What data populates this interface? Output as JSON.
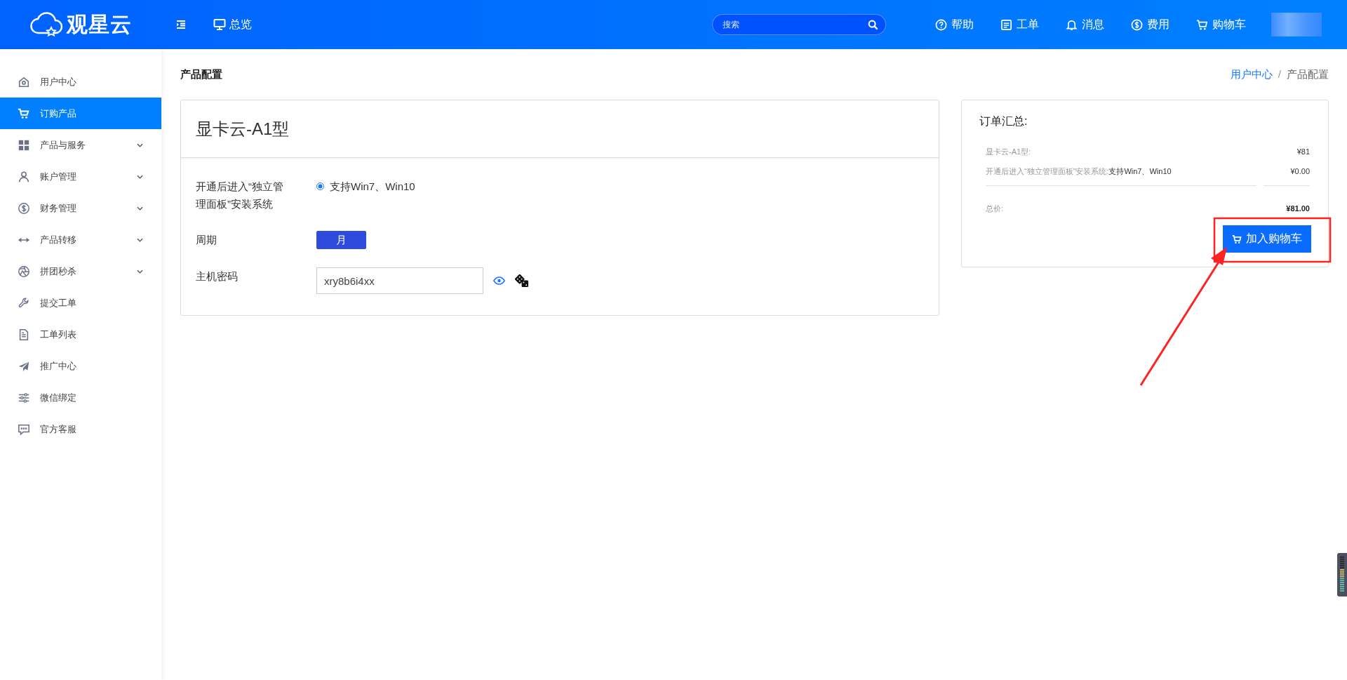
{
  "header": {
    "logo_text": "观星云",
    "nav": [
      {
        "label": "总览"
      }
    ],
    "search": {
      "placeholder": "搜索"
    },
    "actions": [
      {
        "label": "帮助",
        "kind": "help"
      },
      {
        "label": "工单",
        "kind": "ticket"
      },
      {
        "label": "消息",
        "kind": "bell"
      },
      {
        "label": "费用",
        "kind": "dollar"
      },
      {
        "label": "购物车",
        "kind": "cart"
      }
    ]
  },
  "sidebar": {
    "items": [
      {
        "label": "用户中心",
        "selected": false,
        "expandable": false
      },
      {
        "label": "订购产品",
        "selected": true,
        "expandable": false
      },
      {
        "label": "产品与服务",
        "selected": false,
        "expandable": true
      },
      {
        "label": "账户管理",
        "selected": false,
        "expandable": true
      },
      {
        "label": "财务管理",
        "selected": false,
        "expandable": true
      },
      {
        "label": "产品转移",
        "selected": false,
        "expandable": true
      },
      {
        "label": "拼团秒杀",
        "selected": false,
        "expandable": true
      },
      {
        "label": "提交工单",
        "selected": false,
        "expandable": false
      },
      {
        "label": "工单列表",
        "selected": false,
        "expandable": false
      },
      {
        "label": "推广中心",
        "selected": false,
        "expandable": false
      },
      {
        "label": "微信绑定",
        "selected": false,
        "expandable": false
      },
      {
        "label": "官方客服",
        "selected": false,
        "expandable": false
      }
    ]
  },
  "page_title": "产品配置",
  "breadcrumb": {
    "items": [
      {
        "label": "用户中心",
        "link": true
      },
      {
        "label": "产品配置",
        "link": false
      }
    ],
    "separator": "/"
  },
  "product": {
    "name": "显卡云-A1型"
  },
  "config_rows": [
    {
      "kind": "radio",
      "label": "开通后进入“独立管理面板”安装系统",
      "options": [
        {
          "label": "支持Win7、Win10",
          "selected": true
        }
      ]
    },
    {
      "kind": "period",
      "label": "周期",
      "options": [
        {
          "label": "月",
          "selected": true
        }
      ]
    },
    {
      "kind": "password",
      "label": "主机密码",
      "value": "xry8b6i4xx"
    }
  ],
  "summary": {
    "title": "订单汇总:",
    "items": [
      {
        "label": "显卡云-A1型:",
        "value": "",
        "price": "¥81"
      },
      {
        "label": "开通后进入“独立管理面板”安装系统:",
        "value": "支持Win7、Win10",
        "price": "¥0.00"
      }
    ],
    "total": {
      "label": "总价:",
      "price": "¥81.00"
    },
    "button": "加入购物车"
  }
}
